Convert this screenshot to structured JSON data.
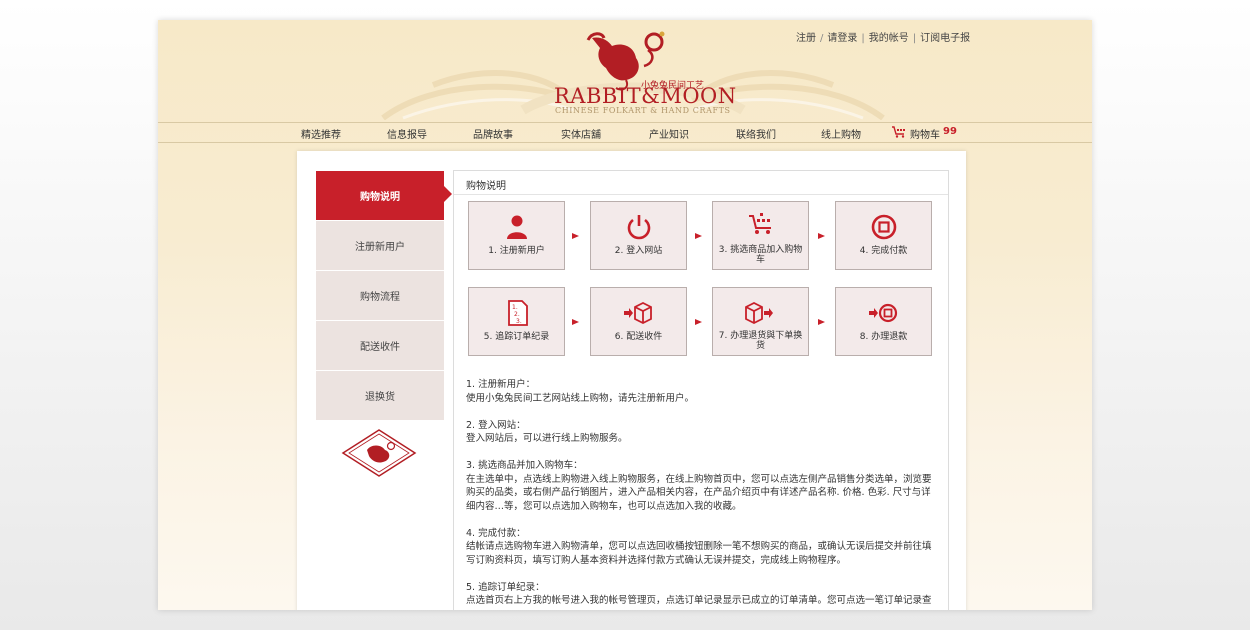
{
  "header": {
    "links": [
      {
        "label": "注册"
      },
      {
        "label": "请登录"
      },
      {
        "label": "我的帐号"
      },
      {
        "label": "订阅电子报"
      }
    ],
    "link_separators": [
      "/",
      "|",
      "|"
    ],
    "logo": {
      "cn": "小兔兔民间工艺",
      "main": "RABBIT&MOON",
      "sub": "CHINESE FOLKART & HAND CRAFTS"
    }
  },
  "nav": {
    "items": [
      {
        "label": "精选推荐"
      },
      {
        "label": "信息报导"
      },
      {
        "label": "品牌故事"
      },
      {
        "label": "实体店舖"
      },
      {
        "label": "产业知识"
      },
      {
        "label": "联络我们"
      },
      {
        "label": "线上购物"
      }
    ],
    "cart_label": "购物车",
    "cart_count": "99"
  },
  "sidebar": {
    "items": [
      {
        "label": "购物说明",
        "active": true
      },
      {
        "label": "注册新用户"
      },
      {
        "label": "购物流程"
      },
      {
        "label": "配送收件"
      },
      {
        "label": "退换货"
      }
    ]
  },
  "content": {
    "title": "购物说明",
    "steps": [
      {
        "label": "1. 注册新用户",
        "icon": "user-icon"
      },
      {
        "label": "2. 登入网站",
        "icon": "power-icon"
      },
      {
        "label": "3. 挑选商品加入购物车",
        "icon": "cart-icon"
      },
      {
        "label": "4. 完成付款",
        "icon": "coin-icon"
      },
      {
        "label": "5. 追踪订单纪录",
        "icon": "list-icon"
      },
      {
        "label": "6. 配送收件",
        "icon": "box-in-icon"
      },
      {
        "label": "7. 办理退货與下单换货",
        "icon": "box-out-icon"
      },
      {
        "label": "8. 办理退款",
        "icon": "coin-refund-icon"
      }
    ],
    "sections": [
      {
        "title": "1. 注册新用户：",
        "body": "使用小兔兔民间工艺网站线上购物，请先注册新用户。"
      },
      {
        "title": "2. 登入网站：",
        "body": "登入网站后，可以进行线上购物服务。"
      },
      {
        "title": "3. 挑选商品并加入购物车：",
        "body": "在主选单中，点选线上购物进入线上购物服务，在线上购物首页中，您可以点选左侧产品销售分类选单，浏览要购买的品类，或右侧产品行销图片，进入产品相关内容，在产品介绍页中有详述产品名称. 价格. 色彩. 尺寸与详细内容…等，您可以点选加入购物车，也可以点选加入我的收藏。"
      },
      {
        "title": "4. 完成付款：",
        "body": "结帐请点选购物车进入购物清单，您可以点选回收桶按钮删除一笔不想购买的商品，或确认无误后提交并前往填写订购资料页，填写订购人基本资料并选择付款方式确认无误并提交，完成线上购物程序。"
      },
      {
        "title": "5. 追踪订单纪录：",
        "body": "点选首页右上方我的帐号进入我的帐号管理页，点选订单记录显示已成立的订单清单。您可点选一笔订单记录查"
      }
    ]
  },
  "colors": {
    "brand_red": "#c8202a",
    "header_bg": "#f7e9c8",
    "step_bg": "#f3eaea"
  }
}
